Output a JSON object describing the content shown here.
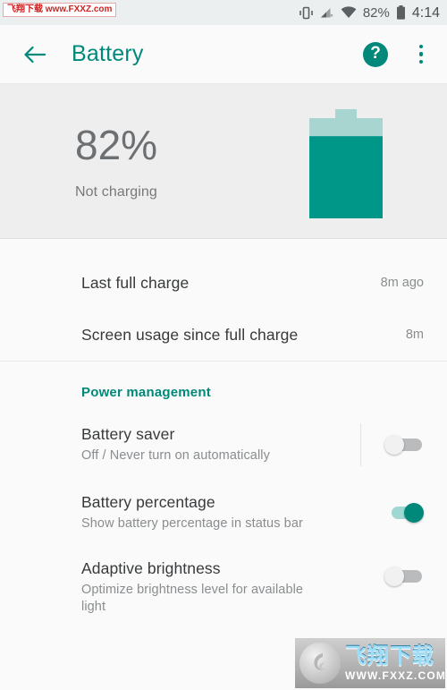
{
  "statusbar": {
    "watermark": "飞翔下载 www.FXXZ.com",
    "battery_percent": "82%",
    "time": "4:14",
    "icons": [
      "vibrate-icon",
      "signal-icon",
      "wifi-icon",
      "battery-icon"
    ]
  },
  "toolbar": {
    "back_icon": "back-arrow-icon",
    "title": "Battery",
    "help_label": "?",
    "overflow_icon": "more-vertical-icon"
  },
  "battery_header": {
    "percent": "82%",
    "status": "Not charging",
    "level_fraction": 82,
    "fill_color": "#009688",
    "shell_color": "#a8d5d0"
  },
  "info_rows": [
    {
      "title": "Last full charge",
      "value": "8m ago"
    },
    {
      "title": "Screen usage since full charge",
      "value": "8m"
    }
  ],
  "power_management": {
    "header": "Power management",
    "items": [
      {
        "title": "Battery saver",
        "subtitle": "Off / Never turn on automatically",
        "toggle": "off"
      },
      {
        "title": "Battery percentage",
        "subtitle": "Show battery percentage in status bar",
        "toggle": "on"
      },
      {
        "title": "Adaptive brightness",
        "subtitle": "Optimize brightness level for available light",
        "toggle": "off"
      }
    ]
  },
  "watermark_bottom": {
    "cn": "飞翔下载",
    "url": "WWW.FXXZ.COM"
  },
  "theme": {
    "accent": "#00897b",
    "header_bg": "#eeeeee",
    "page_bg": "#fafafa"
  }
}
